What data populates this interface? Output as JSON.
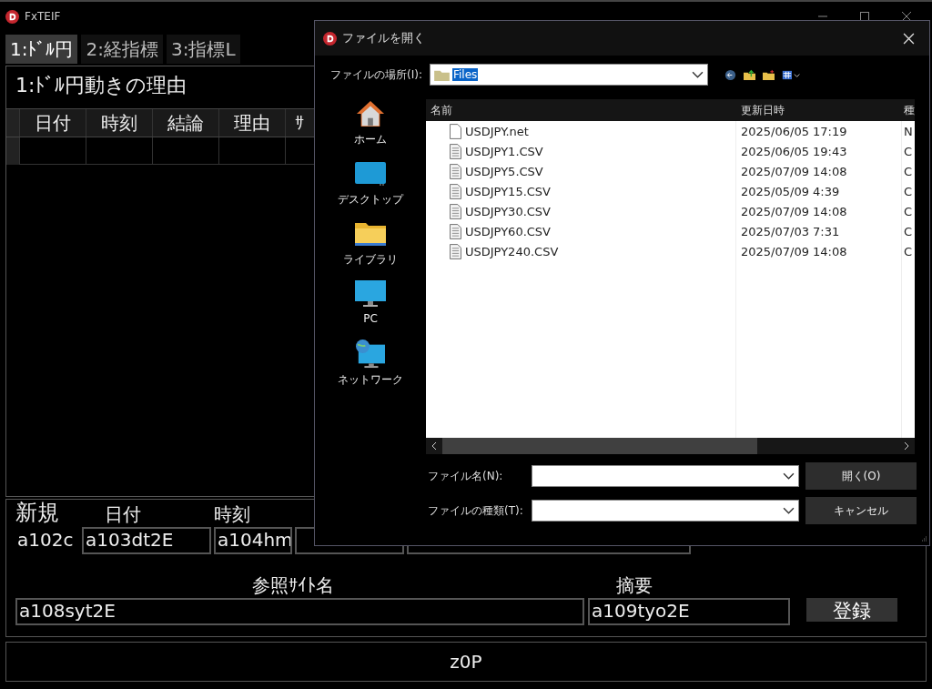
{
  "window": {
    "title": "FxTEIF"
  },
  "tabs": [
    {
      "label": "1:ﾄﾞﾙ円",
      "selected": true
    },
    {
      "label": "2:経指標",
      "selected": false
    },
    {
      "label": "3:指標L",
      "selected": false
    }
  ],
  "panel": {
    "title": "1:ﾄﾞﾙ円動きの理由",
    "table": {
      "columns": [
        "日付",
        "時刻",
        "結論",
        "理由",
        "ｻ"
      ]
    }
  },
  "new_entry": {
    "heading": "新規",
    "date_label": "日付",
    "time_label": "時刻",
    "fields": [
      "a102c",
      "a103dt2E",
      "a104hm"
    ]
  },
  "reference": {
    "site_label": "参照ｻｲﾄ名",
    "site_value": "a108syt2E",
    "summary_label": "摘要",
    "summary_value": "a109tyo2E",
    "register_button": "登録"
  },
  "footer": {
    "text": "z0P"
  },
  "dialog": {
    "title": "ファイルを開く",
    "location_label": "ファイルの場所(I):",
    "location_value": "Files",
    "places": [
      {
        "label": "ホーム",
        "kind": "home"
      },
      {
        "label": "デスクトップ",
        "kind": "desktop"
      },
      {
        "label": "ライブラリ",
        "kind": "library"
      },
      {
        "label": "PC",
        "kind": "pc"
      },
      {
        "label": "ネットワーク",
        "kind": "network"
      }
    ],
    "file_list": {
      "columns": [
        "名前",
        "更新日時",
        "種"
      ],
      "rows": [
        {
          "name": "USDJPY.net",
          "modified": "2025/06/05 17:19",
          "column_3": "N",
          "kind": "blank"
        },
        {
          "name": "USDJPY1.CSV",
          "modified": "2025/06/05 19:43",
          "column_3": "C",
          "kind": "text"
        },
        {
          "name": "USDJPY5.CSV",
          "modified": "2025/07/09 14:08",
          "column_3": "C",
          "kind": "text"
        },
        {
          "name": "USDJPY15.CSV",
          "modified": "2025/05/09 4:39",
          "column_3": "C",
          "kind": "text"
        },
        {
          "name": "USDJPY30.CSV",
          "modified": "2025/07/09 14:08",
          "column_3": "C",
          "kind": "text"
        },
        {
          "name": "USDJPY60.CSV",
          "modified": "2025/07/03 7:31",
          "column_3": "C",
          "kind": "text"
        },
        {
          "name": "USDJPY240.CSV",
          "modified": "2025/07/09 14:08",
          "column_3": "C",
          "kind": "text"
        }
      ]
    },
    "file_name_label": "ファイル名(N):",
    "file_type_label": "ファイルの種類(T):",
    "buttons": [
      "開く(O)",
      "キャンセル"
    ]
  }
}
